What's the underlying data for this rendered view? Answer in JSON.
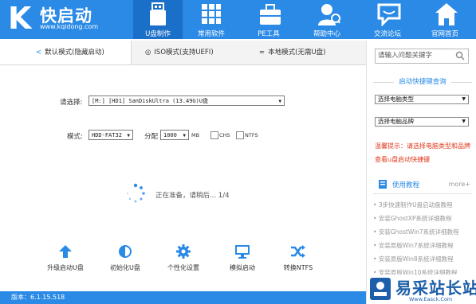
{
  "app": {
    "logo_letter": "K",
    "logo_name": "快启动",
    "logo_url": "www.kqidong.com"
  },
  "nav": [
    {
      "label": "U盘制作",
      "icon": "usb-drive-icon",
      "active": true
    },
    {
      "label": "常用软件",
      "icon": "apps-grid-icon",
      "active": false
    },
    {
      "label": "PE工具",
      "icon": "toolbox-icon",
      "active": false
    },
    {
      "label": "帮助中心",
      "icon": "help-person-icon",
      "active": false
    },
    {
      "label": "交流论坛",
      "icon": "chat-bubble-icon",
      "active": false
    },
    {
      "label": "官网首页",
      "icon": "home-icon",
      "active": false
    }
  ],
  "modes": [
    {
      "label": "默认模式(隐藏启动)",
      "icon": "share-icon",
      "active": true
    },
    {
      "label": "ISO模式(支持UEFI)",
      "icon": "disc-icon",
      "active": false
    },
    {
      "label": "本地模式(无需U盘)",
      "icon": "wifi-icon",
      "active": false
    }
  ],
  "form": {
    "device_label": "请选择:",
    "device_value": "[M:] [HD1] SanDiskUltra (13.49G)U盘",
    "mode_label": "模式:",
    "mode_value": "HDD-FAT32",
    "alloc_label": "分配",
    "alloc_value": "1000",
    "alloc_unit": "MB",
    "chs_label": "CHS",
    "ntfs_label": "NTFS"
  },
  "status_text": "正在准备，请稍后... 1/4",
  "tools": [
    {
      "label": "升级启动U盘",
      "icon": "upload-arrow-icon"
    },
    {
      "label": "初始化U盘",
      "icon": "reset-icon"
    },
    {
      "label": "个性化设置",
      "icon": "gear-icon"
    },
    {
      "label": "模拟启动",
      "icon": "monitor-icon"
    },
    {
      "label": "转换NTFS",
      "icon": "shuffle-icon"
    }
  ],
  "footer": {
    "version": "版本：6.1.15.518"
  },
  "sidebar": {
    "search_placeholder": "请输入问题关键字",
    "hotkey_title": "启动快捷键查询",
    "type_select": "选择电脑类型",
    "brand_select": "选择电脑品牌",
    "tip_text": "温馨提示：请选择电脑类型和品牌查看u盘启动快捷键",
    "tutorial_title": "使用教程",
    "more_label": "more+",
    "articles": [
      "3步快速制作U盘启动盘教程",
      "安装GhostXP系统详细教程",
      "安装GhostWin7系统详细教程",
      "安装原版Win7系统详细教程",
      "安装原版Win8系统详细教程",
      "安装原版Win10系统详细教程"
    ]
  },
  "watermark": {
    "text": "易采站长站",
    "sub": "Www.Easck.Com"
  },
  "colors": {
    "brand_blue": "#2a8ae6",
    "active_nav": "#1a6fc8",
    "tip_red": "#e03a1e"
  }
}
